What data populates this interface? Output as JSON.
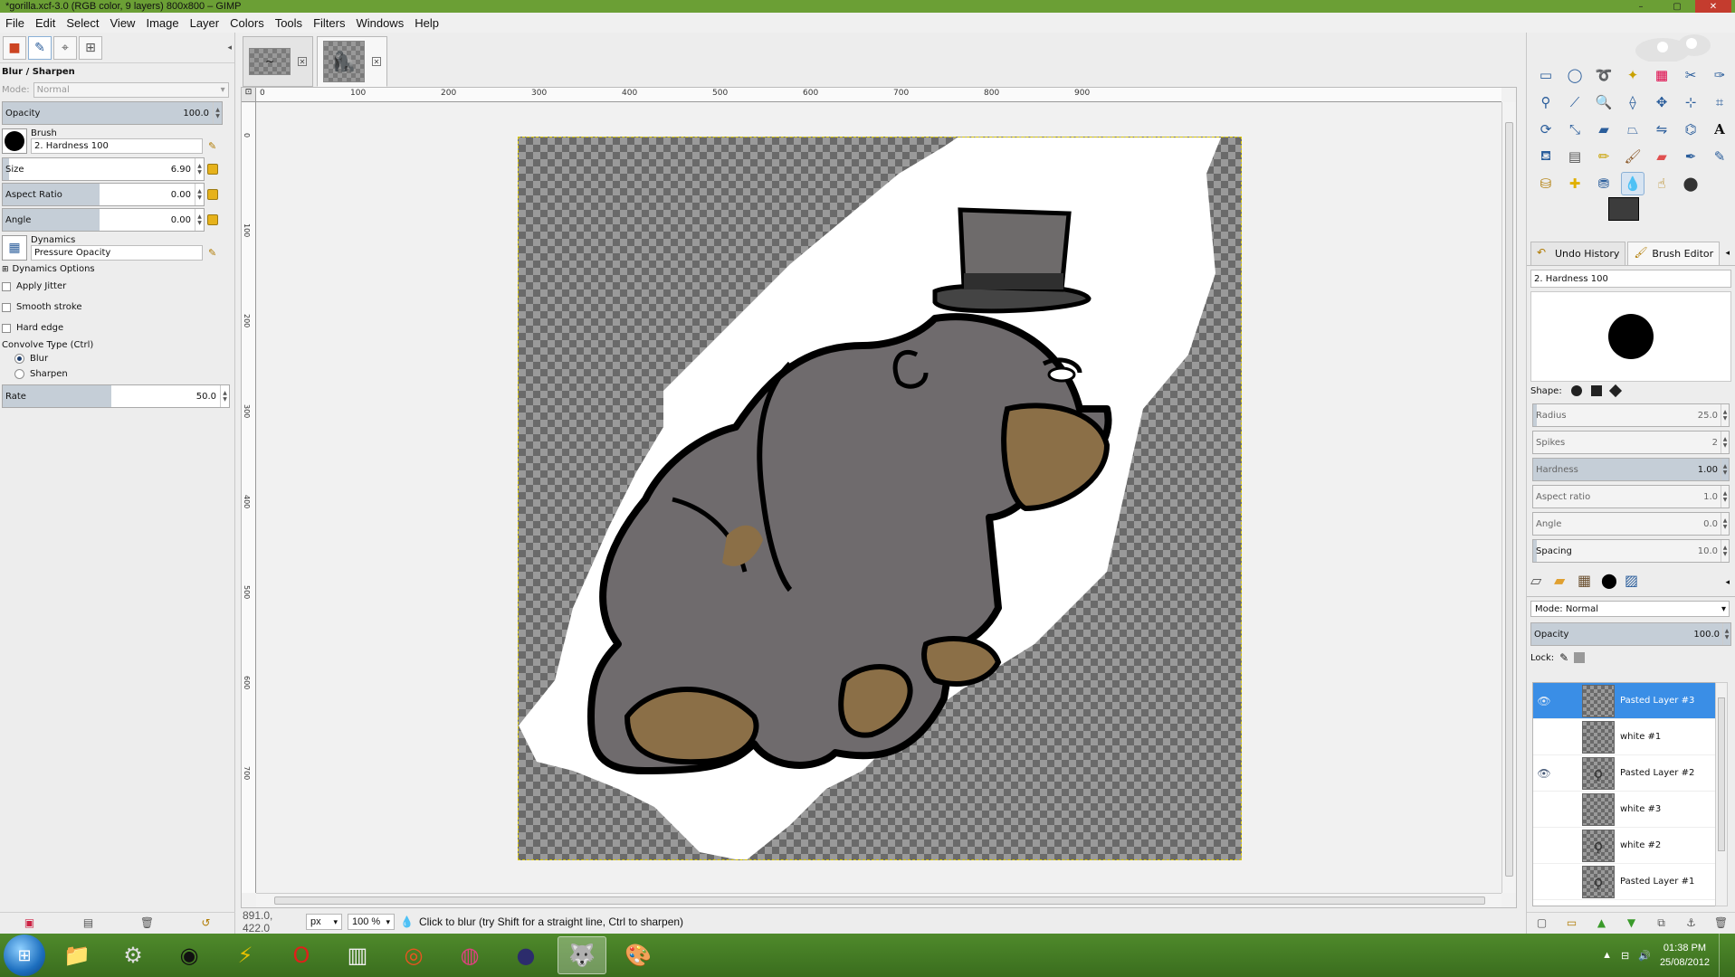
{
  "window": {
    "title": "*gorilla.xcf-3.0 (RGB color, 9 layers) 800x800 – GIMP"
  },
  "menu": [
    "File",
    "Edit",
    "Select",
    "View",
    "Image",
    "Layer",
    "Colors",
    "Tools",
    "Filters",
    "Windows",
    "Help"
  ],
  "tool_options": {
    "title": "Blur / Sharpen",
    "mode_label": "Mode:",
    "mode_value": "Normal",
    "opacity_label": "Opacity",
    "opacity_value": "100.0",
    "brush_label": "Brush",
    "brush_value": "2. Hardness 100",
    "size_label": "Size",
    "size_value": "6.90",
    "aspect_label": "Aspect Ratio",
    "aspect_value": "0.00",
    "angle_label": "Angle",
    "angle_value": "0.00",
    "dynamics_label": "Dynamics",
    "dynamics_value": "Pressure Opacity",
    "dynamics_options": "Dynamics Options",
    "apply_jitter": "Apply Jitter",
    "smooth_stroke": "Smooth stroke",
    "hard_edge": "Hard edge",
    "convolve_type": "Convolve Type  (Ctrl)",
    "blur": "Blur",
    "sharpen": "Sharpen",
    "rate_label": "Rate",
    "rate_value": "50.0"
  },
  "rulers": {
    "h_ticks": [
      "0",
      "100",
      "200",
      "300",
      "400",
      "500",
      "600",
      "700",
      "800",
      "900"
    ],
    "v_ticks": [
      "0",
      "100",
      "200",
      "300",
      "400",
      "500",
      "600",
      "700"
    ]
  },
  "status": {
    "coords": "891.0, 422.0",
    "unit": "px",
    "zoom": "100 %",
    "message": "Click to blur (try Shift for a straight line, Ctrl to sharpen)"
  },
  "right_dock": {
    "tab_undo": "Undo History",
    "tab_brush_editor": "Brush Editor",
    "brush_name": "2. Hardness 100",
    "shape_label": "Shape:",
    "radius_label": "Radius",
    "radius_value": "25.0",
    "spikes_label": "Spikes",
    "spikes_value": "2",
    "hardness_label": "Hardness",
    "hardness_value": "1.00",
    "aspect_label": "Aspect ratio",
    "aspect_value": "1.0",
    "angle_label": "Angle",
    "angle_value": "0.0",
    "spacing_label": "Spacing",
    "spacing_value": "10.0",
    "layers_mode_label": "Mode:",
    "layers_mode_value": "Normal",
    "layers_opacity_label": "Opacity",
    "layers_opacity_value": "100.0",
    "lock_label": "Lock:"
  },
  "layers": [
    {
      "name": "Pasted Layer #3",
      "visible": true,
      "selected": true
    },
    {
      "name": "white #1",
      "visible": false,
      "selected": false
    },
    {
      "name": "Pasted Layer #2",
      "visible": true,
      "selected": false
    },
    {
      "name": "white #3",
      "visible": false,
      "selected": false
    },
    {
      "name": "white #2",
      "visible": false,
      "selected": false
    },
    {
      "name": "Pasted Layer #1",
      "visible": false,
      "selected": false
    }
  ],
  "taskbar": {
    "time": "01:38 PM",
    "date": "25/08/2012"
  },
  "colors": {
    "fg": "#3c3c3c",
    "bg": "#8b6f47",
    "titlebar": "#6b9f35",
    "selection": "#3a8ee6"
  }
}
